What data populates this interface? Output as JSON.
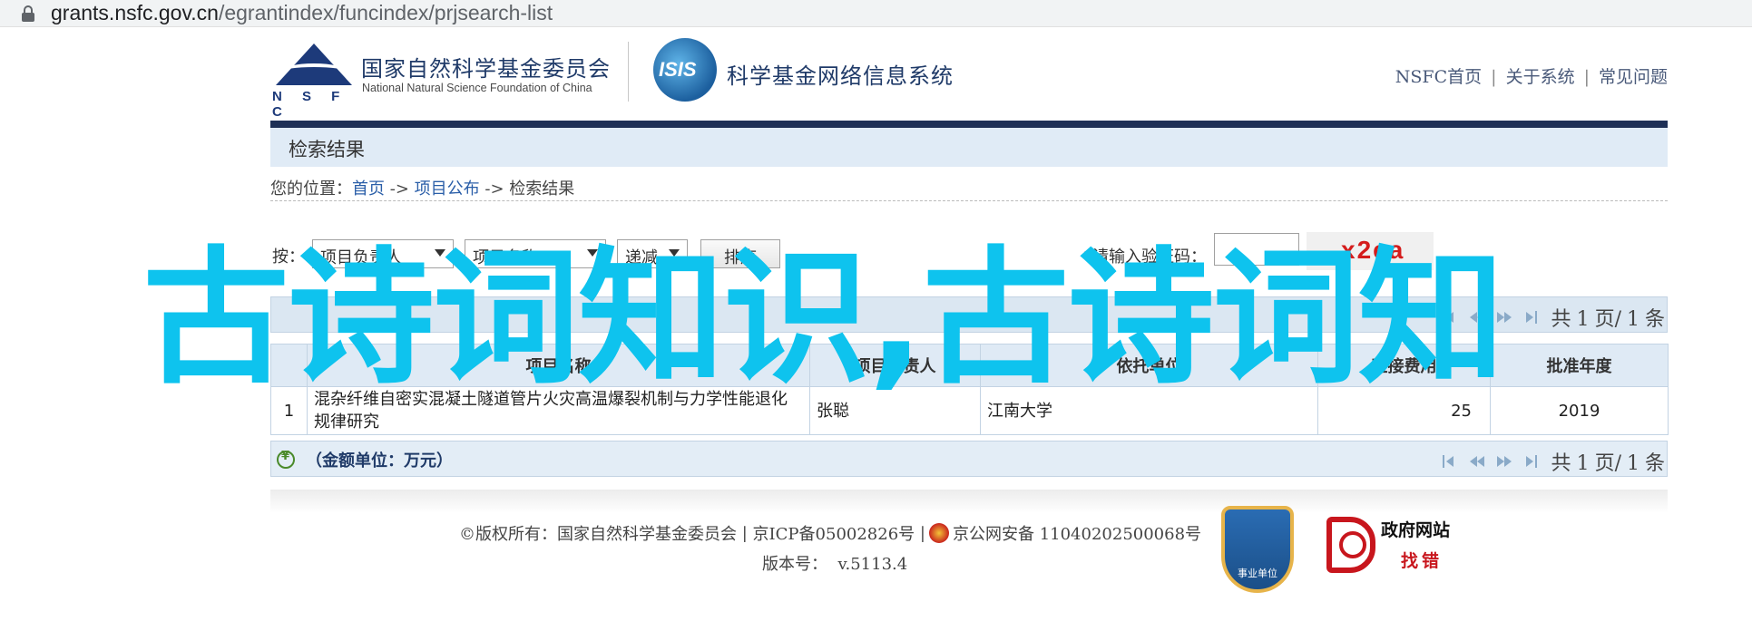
{
  "browser": {
    "url_domain": "grants.nsfc.gov.cn",
    "url_path": "/egrantindex/funcindex/prjsearch-list"
  },
  "header": {
    "logo_text": "N S F C",
    "org_name_cn": "国家自然科学基金委员会",
    "org_name_en": "National Natural Science Foundation of China",
    "isis_logo_text": "ISIS",
    "system_name": "科学基金网络信息系统",
    "links": [
      "NSFC首页",
      "关于系统",
      "常见问题"
    ],
    "link_separator": "|"
  },
  "section_title": "检索结果",
  "breadcrumb": {
    "prefix": "您的位置：",
    "home": "首页",
    "arrow": "->",
    "project_publish": "项目公布",
    "current": "检索结果"
  },
  "search": {
    "label": "按：",
    "sort_field_1": "项目负责人",
    "sort_field_2": "项目名称",
    "sort_order": "递减",
    "sort_button": "排序",
    "captcha_star": "*",
    "captcha_label": "请输入验证码：",
    "captcha_value": "",
    "captcha_image_text": "x2ea"
  },
  "pager": {
    "prefix": "共",
    "current": "1",
    "page_word": "页/",
    "total": "1",
    "suffix": "条"
  },
  "table": {
    "headers": [
      "",
      "项目名称",
      "项目负责人",
      "依托单位",
      "直接费用",
      "批准年度"
    ],
    "rows": [
      {
        "index": "1",
        "title": "混杂纤维自密实混凝土隧道管片火灾高温爆裂机制与力学性能退化规律研究",
        "leader": "张聪",
        "institution": "江南大学",
        "direct_cost": "25",
        "year": "2019"
      }
    ]
  },
  "amount_unit": "（金额单位：万元）",
  "footer": {
    "copyright": "©版权所有：国家自然科学基金委员会",
    "sep": "|",
    "icp": "京ICP备05002826号",
    "police": "京公网安备 11040202500068号",
    "version_label": "版本号：",
    "version_value": "v.5113.4",
    "shield_badge": "事业单位",
    "gov_badge_title": "政府网站",
    "gov_badge_sub": "找错"
  },
  "overlay_text": "古诗词知识,古诗词知",
  "colors": {
    "navy": "#1e3056",
    "header_bg": "#e0ebf6",
    "link": "#2a5ea8",
    "overlay": "#0ec3ee",
    "captcha": "#d41c1c"
  }
}
